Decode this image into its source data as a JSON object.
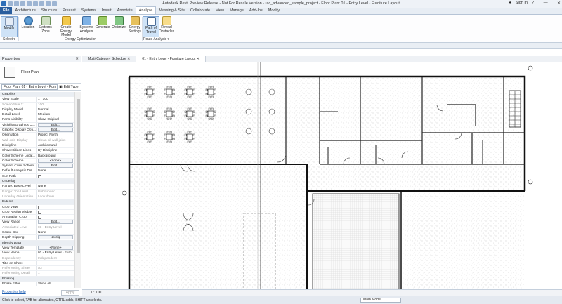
{
  "window": {
    "title": "Autodesk Revit Preview Release - Not For Resale Version - rac_advanced_sample_project - Floor Plan: 01 - Entry Level - Furniture Layout",
    "sign_in": "Sign In",
    "help": "?"
  },
  "ribbon_tabs": [
    {
      "label": "File"
    },
    {
      "label": "Architecture"
    },
    {
      "label": "Structure"
    },
    {
      "label": "Precast"
    },
    {
      "label": "Systems"
    },
    {
      "label": "Insert"
    },
    {
      "label": "Annotate"
    },
    {
      "label": "Analyze"
    },
    {
      "label": "Massing & Site"
    },
    {
      "label": "Collaborate"
    },
    {
      "label": "View"
    },
    {
      "label": "Manage"
    },
    {
      "label": "Add-Ins"
    },
    {
      "label": "Modify"
    }
  ],
  "ribbon": {
    "modify": "Modify",
    "location": "Location",
    "systems_zone": "Systems-Zone",
    "create_energy_model": "Create Energy Model",
    "systems_analysis": "Systems Analysis",
    "generate": "Generate",
    "optimize": "Optimize",
    "energy_settings": "Energy Settings",
    "path_of_travel": "Path of Travel",
    "reveal_obstacles": "Reveal Obstacles",
    "select_panel": "Select ▾",
    "energy_optimization": "Energy Optimization",
    "route_analysis": "Route Analysis ▾"
  },
  "properties": {
    "title": "Properties",
    "type_name": "Floor Plan",
    "instance": "Floor Plan: 01 - Entry Level - Furn",
    "edit_type": "Edit Type",
    "rows": [
      {
        "k": "Graphics",
        "section": true
      },
      {
        "k": "View Scale",
        "v": "1 : 100"
      },
      {
        "k": "Scale Value    1:",
        "v": "100",
        "grey": true
      },
      {
        "k": "Display Model",
        "v": "Normal"
      },
      {
        "k": "Detail Level",
        "v": "Medium"
      },
      {
        "k": "Parts Visibility",
        "v": "Show Original"
      },
      {
        "k": "Visibility/Graphics O...",
        "btn": "Edit..."
      },
      {
        "k": "Graphic Display Opti...",
        "btn": "Edit..."
      },
      {
        "k": "Orientation",
        "v": "Project North"
      },
      {
        "k": "Wall Join Display",
        "v": "Clean all wall joins",
        "grey": true
      },
      {
        "k": "Discipline",
        "v": "Architectural"
      },
      {
        "k": "Show Hidden Lines",
        "v": "By Discipline"
      },
      {
        "k": "Color Scheme Locat...",
        "v": "Background"
      },
      {
        "k": "Color Scheme",
        "btn": "<none>"
      },
      {
        "k": "System Color Schem...",
        "btn": "Edit..."
      },
      {
        "k": "Default Analysis Dis...",
        "v": "None"
      },
      {
        "k": "Sun Path",
        "chk": true
      },
      {
        "k": "Underlay",
        "section": true
      },
      {
        "k": "Range: Base Level",
        "v": "None"
      },
      {
        "k": "Range: Top Level",
        "v": "Unbounded",
        "grey": true
      },
      {
        "k": "Underlay Orientation",
        "v": "Look down",
        "grey": true
      },
      {
        "k": "Extents",
        "section": true
      },
      {
        "k": "Crop View",
        "chk": true
      },
      {
        "k": "Crop Region Visible",
        "chk": true
      },
      {
        "k": "Annotation Crop",
        "chk": true
      },
      {
        "k": "View Range",
        "btn": "Edit..."
      },
      {
        "k": "Associated Level",
        "v": "01 - Entry Level",
        "grey": true
      },
      {
        "k": "Scope Box",
        "v": "None"
      },
      {
        "k": "Depth Clipping",
        "btn": "No clip"
      },
      {
        "k": "Identity Data",
        "section": true
      },
      {
        "k": "View Template",
        "btn": "<None>"
      },
      {
        "k": "View Name",
        "v": "01 - Entry Level - Furn..."
      },
      {
        "k": "Dependency",
        "v": "Independent",
        "grey": true
      },
      {
        "k": "Title on Sheet",
        "v": ""
      },
      {
        "k": "Referencing Sheet",
        "v": "A2",
        "grey": true
      },
      {
        "k": "Referencing Detail",
        "v": "1",
        "grey": true
      },
      {
        "k": "Phasing",
        "section": true
      },
      {
        "k": "Phase Filter",
        "v": "Show All"
      }
    ],
    "help_link": "Properties help",
    "apply": "Apply"
  },
  "view_tabs": [
    {
      "label": "Multi-Category Schedule"
    },
    {
      "label": "01 - Entry Level - Furniture Layout"
    }
  ],
  "view_control": {
    "scale": "1 : 100"
  },
  "status": {
    "message": "Click to select, TAB for alternates, CTRL adds, SHIFT unselects.",
    "model": "Main Model"
  }
}
